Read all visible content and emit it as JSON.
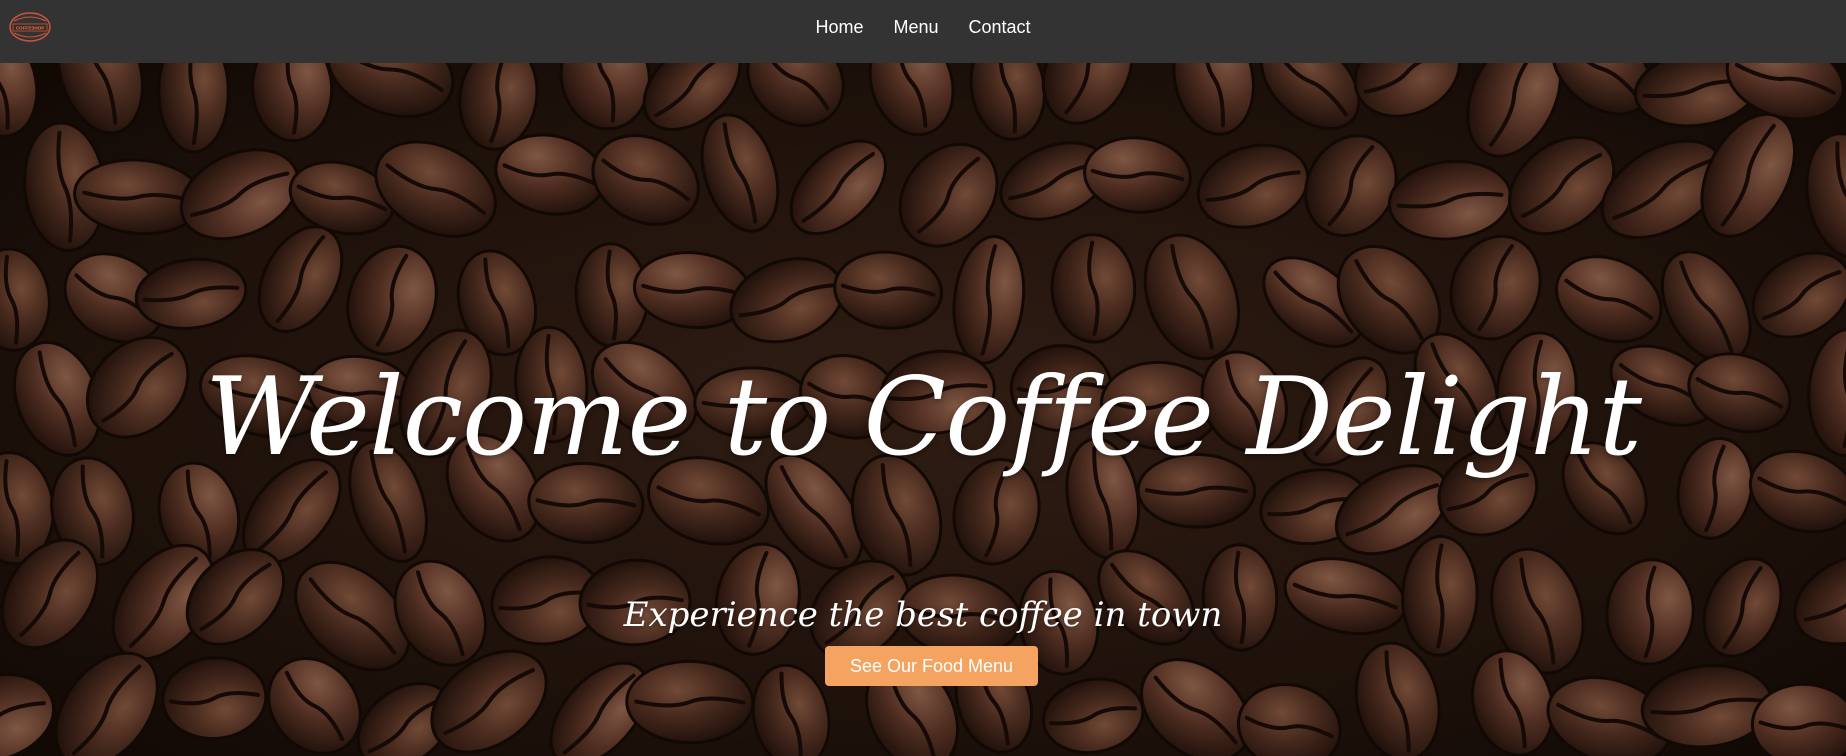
{
  "navbar": {
    "logo_text": "COFFESHOP",
    "links": [
      {
        "label": "Home"
      },
      {
        "label": "Menu"
      },
      {
        "label": "Contact"
      }
    ],
    "background": "#333333"
  },
  "hero": {
    "title": "Welcome to Coffee Delight",
    "subtitle": "Experience the best coffee in town",
    "cta_label": "See Our Food Menu",
    "cta_color": "#f4a460",
    "background_image": "coffee-beans"
  },
  "icons": {
    "logo": "coffee-shop-logo-icon"
  }
}
